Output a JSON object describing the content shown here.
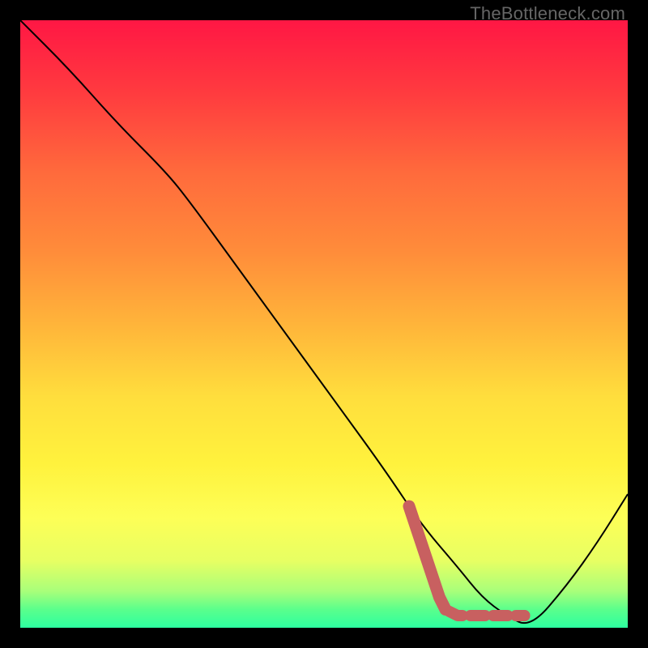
{
  "watermark": "TheBottleneck.com",
  "chart_data": {
    "type": "line",
    "title": "",
    "xlabel": "",
    "ylabel": "",
    "xlim": [
      0,
      100
    ],
    "ylim": [
      0,
      100
    ],
    "background_gradient": {
      "stops": [
        {
          "offset": 0,
          "color": "#ff1744"
        },
        {
          "offset": 12,
          "color": "#ff3b3f"
        },
        {
          "offset": 25,
          "color": "#ff6a3c"
        },
        {
          "offset": 38,
          "color": "#ff8c3a"
        },
        {
          "offset": 50,
          "color": "#ffb43a"
        },
        {
          "offset": 62,
          "color": "#ffde3d"
        },
        {
          "offset": 73,
          "color": "#fff23d"
        },
        {
          "offset": 82,
          "color": "#fdff57"
        },
        {
          "offset": 89,
          "color": "#e7ff63"
        },
        {
          "offset": 94,
          "color": "#a8ff7a"
        },
        {
          "offset": 97,
          "color": "#5aff8c"
        },
        {
          "offset": 100,
          "color": "#2dffa0"
        }
      ]
    },
    "series": [
      {
        "name": "bottleneck-curve",
        "color": "#000000",
        "width": 2,
        "x": [
          0,
          8,
          16,
          24,
          28,
          36,
          44,
          52,
          60,
          66,
          72,
          76,
          80,
          84,
          90,
          95,
          100
        ],
        "y": [
          100,
          92,
          83,
          75,
          70,
          59,
          48,
          37,
          26,
          17,
          10,
          5,
          2,
          0,
          7,
          14,
          22
        ]
      },
      {
        "name": "highlight-marker",
        "color": "#c86060",
        "type": "marker-path",
        "points": [
          {
            "x": 64,
            "y": 20
          },
          {
            "x": 65,
            "y": 17
          },
          {
            "x": 66,
            "y": 14
          },
          {
            "x": 67,
            "y": 11
          },
          {
            "x": 68,
            "y": 8
          },
          {
            "x": 69,
            "y": 5
          },
          {
            "x": 70,
            "y": 3
          },
          {
            "x": 72,
            "y": 2
          },
          {
            "x": 74,
            "y": 2
          },
          {
            "x": 77,
            "y": 2
          },
          {
            "x": 80,
            "y": 2
          },
          {
            "x": 83,
            "y": 2
          }
        ]
      }
    ]
  }
}
